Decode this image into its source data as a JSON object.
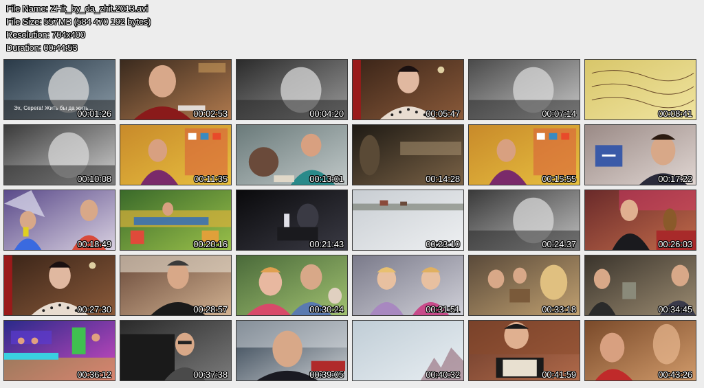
{
  "info": {
    "file_name": "File Name: ZHit_by_da_zhit.2013.avi",
    "file_size": "File Size: 557MB (584 470 192 bytes)",
    "resolution": "Resolution: 704x400",
    "duration": "Duration: 00:44:53"
  },
  "thumbnails": [
    {
      "time": "00:01:26",
      "caption": "Эх, Серега! Жить бы да жить...",
      "bg": [
        "#2a3a48",
        "#8a9aa6"
      ],
      "shapes": "bw"
    },
    {
      "time": "00:02:53",
      "caption": "",
      "bg": [
        "#3a2a1e",
        "#b07a4e"
      ],
      "shapes": "man-red"
    },
    {
      "time": "00:04:20",
      "caption": "",
      "bg": [
        "#2b2b2b",
        "#9a9a9a"
      ],
      "shapes": "bw"
    },
    {
      "time": "00:05:47",
      "caption": "",
      "bg": [
        "#3a2418",
        "#8a5a3a"
      ],
      "shapes": "woman-dots"
    },
    {
      "time": "00:07:14",
      "caption": "",
      "bg": [
        "#4a4a4a",
        "#c8c8c8"
      ],
      "shapes": "bw"
    },
    {
      "time": "00:08:41",
      "caption": "",
      "bg": [
        "#d8c66a",
        "#f0e4a0"
      ],
      "shapes": "paper"
    },
    {
      "time": "00:10:08",
      "caption": "",
      "bg": [
        "#3a3a3a",
        "#d0d0d0"
      ],
      "shapes": "bw"
    },
    {
      "time": "00:11:35",
      "caption": "",
      "bg": [
        "#c88a2a",
        "#e8c040"
      ],
      "shapes": "woman-purple"
    },
    {
      "time": "00:13:01",
      "caption": "",
      "bg": [
        "#6a7a7a",
        "#c0c8c8"
      ],
      "shapes": "outdoor"
    },
    {
      "time": "00:14:28",
      "caption": "",
      "bg": [
        "#1e1a14",
        "#7a6246"
      ],
      "shapes": "dark"
    },
    {
      "time": "00:15:55",
      "caption": "",
      "bg": [
        "#c88a2a",
        "#e8c040"
      ],
      "shapes": "woman-purple"
    },
    {
      "time": "00:17:22",
      "caption": "",
      "bg": [
        "#9a8a86",
        "#e0d6d2"
      ],
      "shapes": "man-tv"
    },
    {
      "time": "00:18:49",
      "caption": "",
      "bg": [
        "#5a4a8a",
        "#d8d0e0"
      ],
      "shapes": "studio"
    },
    {
      "time": "00:20:16",
      "caption": "",
      "bg": [
        "#3a6a2a",
        "#9ac04a"
      ],
      "shapes": "jungle"
    },
    {
      "time": "00:21:43",
      "caption": "",
      "bg": [
        "#0a0a0c",
        "#3a3a44"
      ],
      "shapes": "piano"
    },
    {
      "time": "00:23:10",
      "caption": "",
      "bg": [
        "#c8cdd2",
        "#eef0f2"
      ],
      "shapes": "snow"
    },
    {
      "time": "00:24:37",
      "caption": "",
      "bg": [
        "#3a3a3a",
        "#c0c0c0"
      ],
      "shapes": "bw"
    },
    {
      "time": "00:26:03",
      "caption": "",
      "bg": [
        "#6a2a2a",
        "#c06a4a"
      ],
      "shapes": "woman-tea"
    },
    {
      "time": "00:27:30",
      "caption": "",
      "bg": [
        "#3a2418",
        "#8a5a3a"
      ],
      "shapes": "woman-dots"
    },
    {
      "time": "00:28:57",
      "caption": "",
      "bg": [
        "#6a4a3a",
        "#d0b090"
      ],
      "shapes": "man-dark"
    },
    {
      "time": "00:30:24",
      "caption": "",
      "bg": [
        "#4a6a3a",
        "#a0c070"
      ],
      "shapes": "couple"
    },
    {
      "time": "00:31:51",
      "caption": "",
      "bg": [
        "#7a7a8a",
        "#d0d0d8"
      ],
      "shapes": "girls"
    },
    {
      "time": "00:33:18",
      "caption": "",
      "bg": [
        "#5a4a3a",
        "#c0a070"
      ],
      "shapes": "crowd"
    },
    {
      "time": "00:34:45",
      "caption": "",
      "bg": [
        "#3a342c",
        "#9a8a70"
      ],
      "shapes": "suits"
    },
    {
      "time": "00:36:12",
      "caption": "",
      "bg": [
        "#2a2a8a",
        "#d04ac0"
      ],
      "shapes": "show"
    },
    {
      "time": "00:37:38",
      "caption": "",
      "bg": [
        "#2a2a2a",
        "#7a7a7a"
      ],
      "shapes": "woman-sofa"
    },
    {
      "time": "00:39:05",
      "caption": "",
      "bg": [
        "#2a3a4a",
        "#c8ccd0"
      ],
      "shapes": "man-snow"
    },
    {
      "time": "00:40:32",
      "caption": "",
      "bg": [
        "#c0cdd6",
        "#e8eef2"
      ],
      "shapes": "sky"
    },
    {
      "time": "00:41:59",
      "caption": "",
      "bg": [
        "#6a3a2a",
        "#b06a4a"
      ],
      "shapes": "accordion"
    },
    {
      "time": "00:43:26",
      "caption": "",
      "bg": [
        "#7a4a2a",
        "#d09a6a"
      ],
      "shapes": "warm"
    }
  ]
}
